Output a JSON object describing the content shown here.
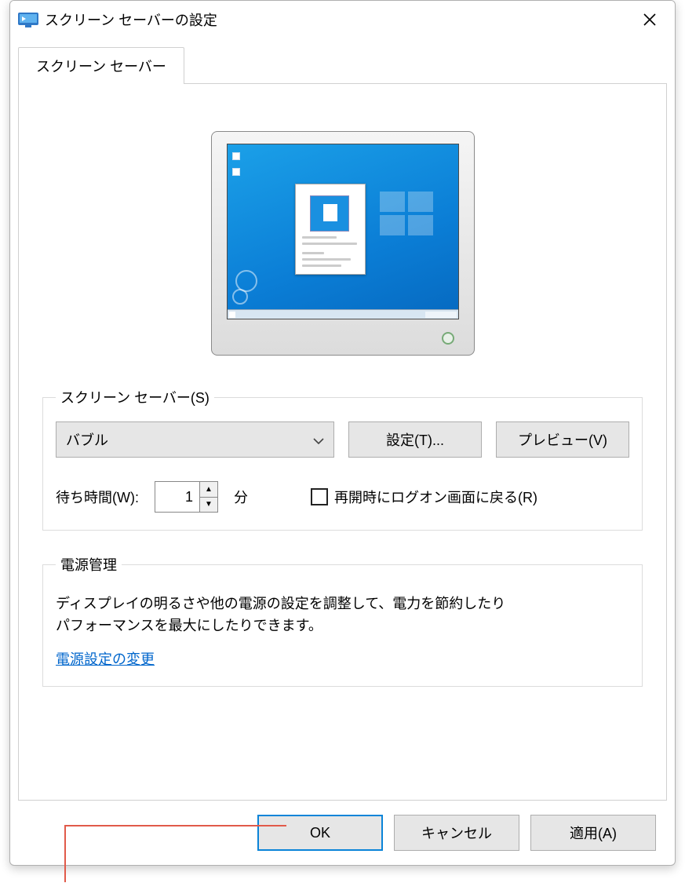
{
  "titlebar": {
    "title": "スクリーン セーバーの設定"
  },
  "tab": {
    "label": "スクリーン セーバー"
  },
  "screensaver_group": {
    "legend": "スクリーン セーバー(S)",
    "selected": "バブル",
    "settings_button": "設定(T)...",
    "preview_button": "プレビュー(V)",
    "wait_label": "待ち時間(W):",
    "wait_value": "1",
    "wait_unit": "分",
    "resume_checkbox_label": "再開時にログオン画面に戻る(R)",
    "resume_checked": false
  },
  "power_group": {
    "legend": "電源管理",
    "description_line1": "ディスプレイの明るさや他の電源の設定を調整して、電力を節約したり",
    "description_line2": "パフォーマンスを最大にしたりできます。",
    "link": "電源設定の変更"
  },
  "footer": {
    "ok": "OK",
    "cancel": "キャンセル",
    "apply": "適用(A)"
  }
}
